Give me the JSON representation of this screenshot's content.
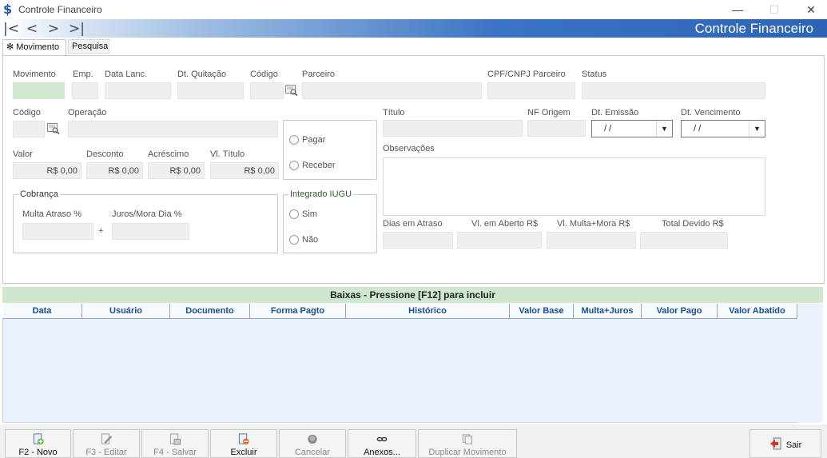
{
  "window": {
    "title": "Controle Financeiro",
    "icon": "dollar-icon"
  },
  "header": {
    "title": "Controle Financeiro"
  },
  "nav": {
    "first": "|<",
    "prev": "<",
    "next": ">",
    "last": ">|"
  },
  "tabs": [
    {
      "label": "✻ Movimento",
      "active": true
    },
    {
      "label": "Pesquisa",
      "active": false
    }
  ],
  "form": {
    "movimento": {
      "label": "Movimento",
      "value": ""
    },
    "emp": {
      "label": "Emp.",
      "value": ""
    },
    "data_lanc": {
      "label": "Data Lanc.",
      "value": ""
    },
    "dt_quitacao": {
      "label": "Dt. Quitação",
      "value": ""
    },
    "codigo_parceiro": {
      "label": "Código",
      "value": ""
    },
    "parceiro": {
      "label": "Parceiro",
      "value": ""
    },
    "cpf_cnpj": {
      "label": "CPF/CNPJ Parceiro",
      "value": ""
    },
    "status": {
      "label": "Status",
      "value": ""
    },
    "codigo_operacao": {
      "label": "Código",
      "value": ""
    },
    "operacao": {
      "label": "Operação",
      "value": ""
    },
    "tipo": {
      "pagar": "Pagar",
      "receber": "Receber"
    },
    "titulo": {
      "label": "Título",
      "value": ""
    },
    "nf_origem": {
      "label": "NF Origem",
      "value": ""
    },
    "dt_emissao": {
      "label": "Dt. Emissão",
      "value": " /  /"
    },
    "dt_vencimento": {
      "label": "Dt. Vencimento",
      "value": " /  /"
    },
    "valor": {
      "label": "Valor",
      "value": "R$ 0,00"
    },
    "desconto": {
      "label": "Desconto",
      "value": "R$ 0,00"
    },
    "acrescimo": {
      "label": "Acréscimo",
      "value": "R$ 0,00"
    },
    "vl_titulo": {
      "label": "Vl. Título",
      "value": "R$ 0,00"
    },
    "observacoes": {
      "label": "Observações",
      "value": ""
    },
    "cobranca": {
      "title": "Cobrança",
      "multa_label": "Multa Atraso %",
      "juros_label": "Juros/Mora Dia %",
      "plus": "+"
    },
    "iugu": {
      "title": "Integrado IUGU",
      "sim": "Sim",
      "nao": "Não"
    },
    "dias_atraso": {
      "label": "Dias em Atraso",
      "value": ""
    },
    "vl_aberto": {
      "label": "Vl. em Aberto R$",
      "value": ""
    },
    "vl_multa_mora": {
      "label": "Vl. Multa+Mora R$",
      "value": ""
    },
    "total_devido": {
      "label": "Total Devido R$",
      "value": ""
    }
  },
  "baixas": {
    "title": "Baixas - Pressione [F12] para incluir",
    "columns": [
      "Data",
      "Usuário",
      "Documento",
      "Forma Pagto",
      "Histórico",
      "Valor Base",
      "Multa+Juros",
      "Valor Pago",
      "Valor Abatido"
    ]
  },
  "toolbar": {
    "novo": "F2 - Novo",
    "editar": "F3 - Editar",
    "salvar": "F4 - Salvar",
    "excluir": "Excluir",
    "cancelar": "Cancelar",
    "anexos": "Anexos...",
    "duplicar": "Duplicar Movimento",
    "sair": "Sair"
  },
  "colors": {
    "accent": "#2c64b8",
    "green_field": "#cfe8cf",
    "grid_header": "#cfe7cf"
  }
}
